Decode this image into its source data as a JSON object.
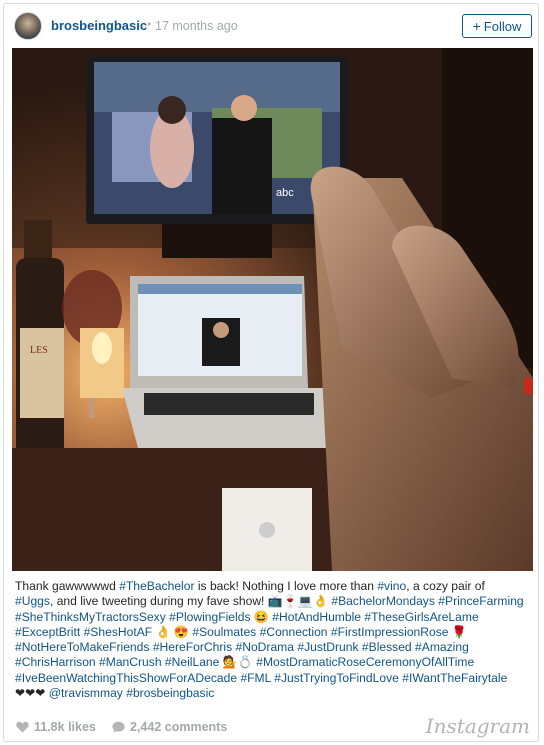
{
  "post": {
    "username": "brosbeingbasic",
    "separator": "•",
    "timestamp": "17 months ago",
    "follow_label": "Follow",
    "follow_plus": "+"
  },
  "caption": {
    "lines": [
      [
        {
          "t": "Thank gawwwwwd "
        },
        {
          "t": "#TheBachelor",
          "tag": true
        },
        {
          "t": " is back! Nothing I love more than "
        },
        {
          "t": "#vino",
          "tag": true
        },
        {
          "t": ", a cozy pair of"
        }
      ],
      [
        {
          "t": "#Uggs",
          "tag": true
        },
        {
          "t": ", and live tweeting during my fave show! 📺🍷💻👌 "
        },
        {
          "t": "#BachelorMondays",
          "tag": true
        },
        {
          "t": " "
        },
        {
          "t": "#PrinceFarming",
          "tag": true
        }
      ],
      [
        {
          "t": "#SheThinksMyTractorsSexy",
          "tag": true
        },
        {
          "t": " "
        },
        {
          "t": "#PlowingFields",
          "tag": true
        },
        {
          "t": " 😆 "
        },
        {
          "t": "#HotAndHumble",
          "tag": true
        },
        {
          "t": " "
        },
        {
          "t": "#TheseGirlsAreLame",
          "tag": true
        }
      ],
      [
        {
          "t": "#ExceptBritt",
          "tag": true
        },
        {
          "t": " "
        },
        {
          "t": "#ShesHotAF",
          "tag": true
        },
        {
          "t": " 👌 😍 "
        },
        {
          "t": "#Soulmates",
          "tag": true
        },
        {
          "t": " "
        },
        {
          "t": "#Connection",
          "tag": true
        },
        {
          "t": " "
        },
        {
          "t": "#FirstImpressionRose",
          "tag": true
        },
        {
          "t": " 🌹"
        }
      ],
      [
        {
          "t": "#NotHereToMakeFriends",
          "tag": true
        },
        {
          "t": " "
        },
        {
          "t": "#HereForChris",
          "tag": true
        },
        {
          "t": " "
        },
        {
          "t": "#NoDrama",
          "tag": true
        },
        {
          "t": " "
        },
        {
          "t": "#JustDrunk",
          "tag": true
        },
        {
          "t": " "
        },
        {
          "t": "#Blessed",
          "tag": true
        },
        {
          "t": " "
        },
        {
          "t": "#Amazing",
          "tag": true
        }
      ],
      [
        {
          "t": "#ChrisHarrison",
          "tag": true
        },
        {
          "t": " "
        },
        {
          "t": "#ManCrush",
          "tag": true
        },
        {
          "t": " "
        },
        {
          "t": "#NeilLane",
          "tag": true
        },
        {
          "t": " 💁💍 "
        },
        {
          "t": "#MostDramaticRoseCeremonyOfAllTime",
          "tag": true
        }
      ],
      [
        {
          "t": "#IveBeenWatchingThisShowForADecade",
          "tag": true
        },
        {
          "t": " "
        },
        {
          "t": "#FML",
          "tag": true
        },
        {
          "t": " "
        },
        {
          "t": "#JustTryingToFindLove",
          "tag": true
        },
        {
          "t": " "
        },
        {
          "t": "#IWantTheFairytale",
          "tag": true
        }
      ],
      [
        {
          "t": "❤❤❤ "
        },
        {
          "t": "@travismmay",
          "tag": true
        },
        {
          "t": " "
        },
        {
          "t": "#brosbeingbasic",
          "tag": true
        }
      ]
    ]
  },
  "stats": {
    "likes": "11.8k likes",
    "comments": "2,442 comments"
  },
  "brand": "Instagram",
  "colors": {
    "link": "#125688",
    "muted": "#a5a7aa"
  },
  "icons": [
    "avatar",
    "camera-icon",
    "heart-icon",
    "comment-icon"
  ]
}
